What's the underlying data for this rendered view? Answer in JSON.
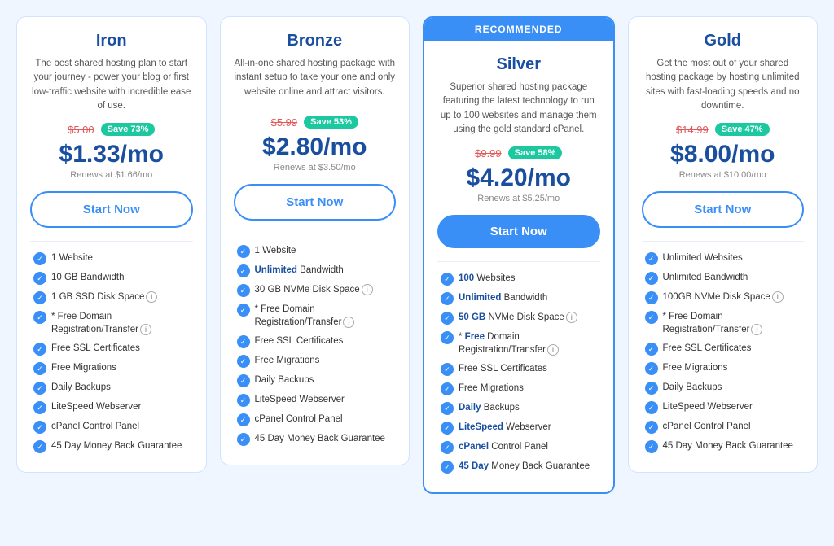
{
  "plans": [
    {
      "id": "iron",
      "name": "Iron",
      "recommended": false,
      "desc": "The best shared hosting plan to start your journey - power your blog or first low-traffic website with incredible ease of use.",
      "original_price": "$5.00",
      "save": "Save 73%",
      "main_price": "$1.33/mo",
      "renews": "Renews at $1.66/mo",
      "btn_label": "Start Now",
      "features": [
        {
          "text": "1 Website",
          "bold": ""
        },
        {
          "text": "10 GB Bandwidth",
          "bold": ""
        },
        {
          "text": "1 GB SSD Disk Space",
          "bold": "",
          "info": true
        },
        {
          "text": "* Free Domain Registration/Transfer",
          "bold": "",
          "info": true
        },
        {
          "text": "Free SSL Certificates",
          "bold": ""
        },
        {
          "text": "Free Migrations",
          "bold": ""
        },
        {
          "text": "Daily Backups",
          "bold": ""
        },
        {
          "text": "LiteSpeed Webserver",
          "bold": ""
        },
        {
          "text": "cPanel Control Panel",
          "bold": ""
        },
        {
          "text": "45 Day Money Back Guarantee",
          "bold": ""
        }
      ]
    },
    {
      "id": "bronze",
      "name": "Bronze",
      "recommended": false,
      "desc": "All-in-one shared hosting package with instant setup to take your one and only website online and attract visitors.",
      "original_price": "$5.99",
      "save": "Save 53%",
      "main_price": "$2.80/mo",
      "renews": "Renews at $3.50/mo",
      "btn_label": "Start Now",
      "features": [
        {
          "text": "1 Website",
          "bold": ""
        },
        {
          "text": "Unlimited Bandwidth",
          "bold": "Unlimited"
        },
        {
          "text": "30 GB NVMe Disk Space",
          "bold": "",
          "info": true
        },
        {
          "text": "* Free Domain Registration/Transfer",
          "bold": "",
          "info": true
        },
        {
          "text": "Free SSL Certificates",
          "bold": ""
        },
        {
          "text": "Free Migrations",
          "bold": ""
        },
        {
          "text": "Daily Backups",
          "bold": ""
        },
        {
          "text": "LiteSpeed Webserver",
          "bold": ""
        },
        {
          "text": "cPanel Control Panel",
          "bold": ""
        },
        {
          "text": "45 Day Money Back Guarantee",
          "bold": ""
        }
      ]
    },
    {
      "id": "silver",
      "name": "Silver",
      "recommended": true,
      "recommended_label": "RECOMMENDED",
      "desc": "Superior shared hosting package featuring the latest technology to run up to 100 websites and manage them using the gold standard cPanel.",
      "original_price": "$9.99",
      "save": "Save 58%",
      "main_price": "$4.20/mo",
      "renews": "Renews at $5.25/mo",
      "btn_label": "Start Now",
      "features": [
        {
          "text": "100 Websites",
          "bold": "100"
        },
        {
          "text": "Unlimited Bandwidth",
          "bold": "Unlimited"
        },
        {
          "text": "50 GB NVMe Disk Space",
          "bold": "50 GB",
          "info": true
        },
        {
          "text": "* Free Domain Registration/Transfer",
          "bold": "Free",
          "info": true
        },
        {
          "text": "Free SSL Certificates",
          "bold": ""
        },
        {
          "text": "Free Migrations",
          "bold": ""
        },
        {
          "text": "Daily Backups",
          "bold": "Daily"
        },
        {
          "text": "LiteSpeed Webserver",
          "bold": "LiteSpeed"
        },
        {
          "text": "cPanel Control Panel",
          "bold": "cPanel"
        },
        {
          "text": "45 Day Money Back Guarantee",
          "bold": "45 Day"
        }
      ]
    },
    {
      "id": "gold",
      "name": "Gold",
      "recommended": false,
      "desc": "Get the most out of your shared hosting package by hosting unlimited sites with fast-loading speeds and no downtime.",
      "original_price": "$14.99",
      "save": "Save 47%",
      "main_price": "$8.00/mo",
      "renews": "Renews at $10.00/mo",
      "btn_label": "Start Now",
      "features": [
        {
          "text": "Unlimited Websites",
          "bold": ""
        },
        {
          "text": "Unlimited Bandwidth",
          "bold": ""
        },
        {
          "text": "100GB NVMe Disk Space",
          "bold": "",
          "info": true
        },
        {
          "text": "* Free Domain Registration/Transfer",
          "bold": "",
          "info": true
        },
        {
          "text": "Free SSL Certificates",
          "bold": ""
        },
        {
          "text": "Free Migrations",
          "bold": ""
        },
        {
          "text": "Daily Backups",
          "bold": ""
        },
        {
          "text": "LiteSpeed Webserver",
          "bold": ""
        },
        {
          "text": "cPanel Control Panel",
          "bold": ""
        },
        {
          "text": "45 Day Money Back Guarantee",
          "bold": ""
        }
      ]
    }
  ]
}
